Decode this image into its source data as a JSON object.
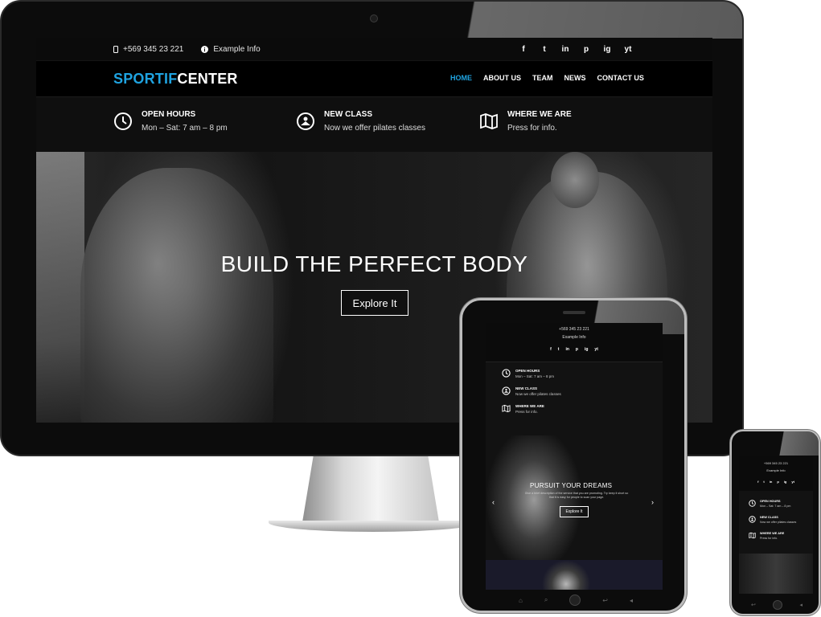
{
  "topbar": {
    "phone": "+569 345 23 221",
    "info": "Example Info",
    "social": [
      "f",
      "t",
      "in",
      "p",
      "ig",
      "yt"
    ]
  },
  "brand": {
    "part1": "SPORTIF",
    "part2": "CENTER",
    "accent": "#1fa3e0"
  },
  "nav": {
    "items": [
      "HOME",
      "ABOUT US",
      "TEAM",
      "NEWS",
      "CONTACT US"
    ],
    "active": "HOME"
  },
  "info": [
    {
      "title": "OPEN HOURS",
      "text": "Mon – Sat: 7 am – 8 pm",
      "icon": "clock-icon"
    },
    {
      "title": "NEW CLASS",
      "text": "Now we offer pilates classes",
      "icon": "class-icon"
    },
    {
      "title": "WHERE WE ARE",
      "text": "Press for info.",
      "icon": "map-icon"
    }
  ],
  "hero": {
    "title": "BUILD THE PERFECT BODY",
    "cta": "Explore It"
  },
  "tablet": {
    "hero_title": "PURSUIT YOUR DREAMS",
    "hero_desc": "Give a brief description of the service that you are promoting. Try keep it short so that it is easy for people to scan your page.",
    "cta": "Explore It",
    "prev": "‹",
    "next": "›",
    "nav_icons": [
      "⌂",
      "⌕",
      "↩",
      "◂"
    ]
  },
  "phone": {
    "nav_icons": [
      "↩",
      "◂"
    ]
  }
}
